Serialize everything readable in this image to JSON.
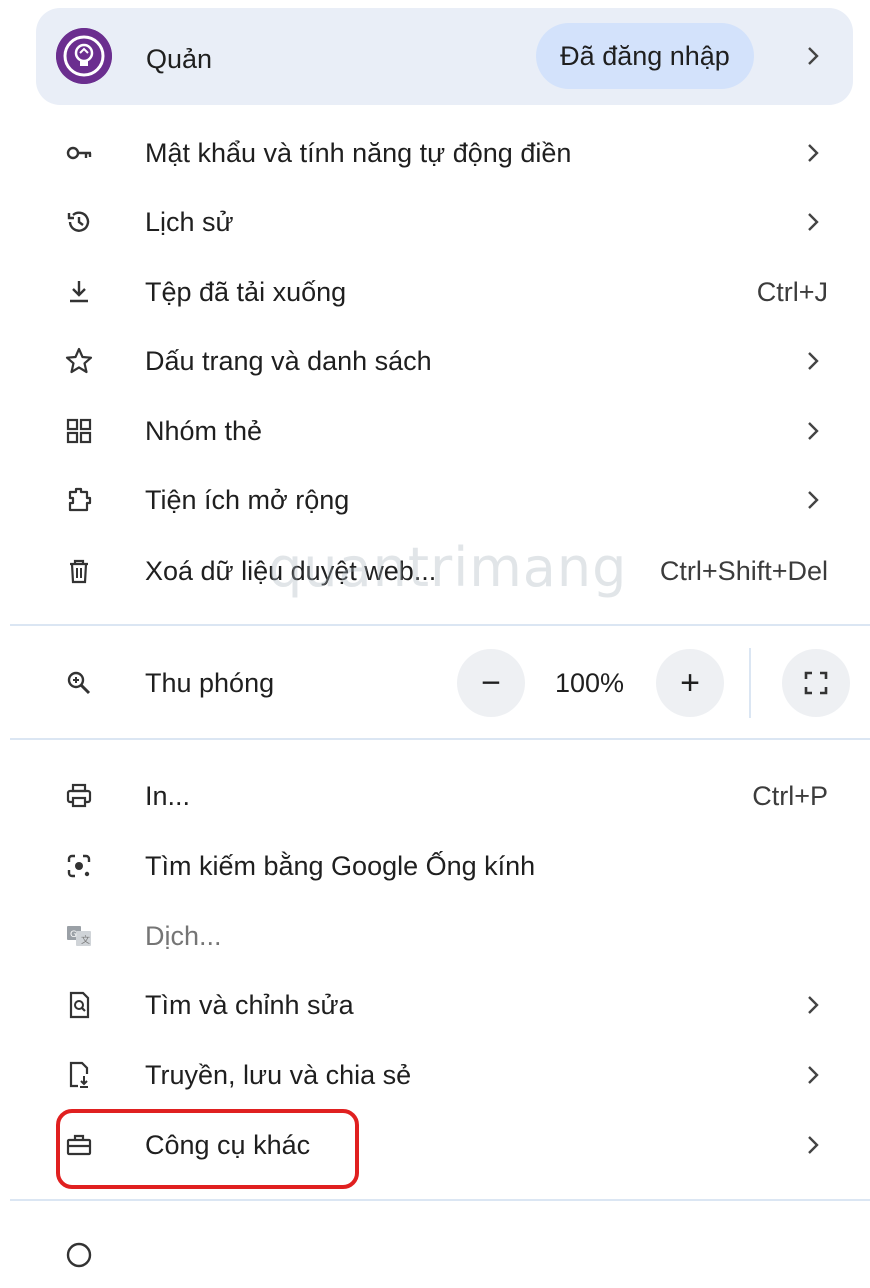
{
  "profile": {
    "name": "Quản",
    "status": "Đã đăng nhập",
    "avatar_color": "#6b2e8f"
  },
  "menu_items": [
    {
      "label": "Mật khẩu và tính năng tự động điền",
      "icon": "key-icon",
      "trailing": "chevron"
    },
    {
      "label": "Lịch sử",
      "icon": "history-icon",
      "trailing": "chevron"
    },
    {
      "label": "Tệp đã tải xuống",
      "icon": "download-icon",
      "shortcut": "Ctrl+J"
    },
    {
      "label": "Dấu trang và danh sách",
      "icon": "star-icon",
      "trailing": "chevron"
    },
    {
      "label": "Nhóm thẻ",
      "icon": "tab-groups-icon",
      "trailing": "chevron"
    },
    {
      "label": "Tiện ích mở rộng",
      "icon": "extension-icon",
      "trailing": "chevron"
    },
    {
      "label": "Xoá dữ liệu duyệt web...",
      "icon": "trash-icon",
      "shortcut": "Ctrl+Shift+Del"
    }
  ],
  "zoom": {
    "label": "Thu phóng",
    "minus": "−",
    "level": "100%",
    "plus": "+"
  },
  "menu_items_2": [
    {
      "label": "In...",
      "icon": "print-icon",
      "shortcut": "Ctrl+P"
    },
    {
      "label": "Tìm kiếm bằng Google Ống kính",
      "icon": "google-lens-icon"
    },
    {
      "label": "Dịch...",
      "icon": "translate-icon",
      "disabled": true
    },
    {
      "label": "Tìm và chỉnh sửa",
      "icon": "find-icon",
      "trailing": "chevron"
    },
    {
      "label": "Truyền, lưu và chia sẻ",
      "icon": "cast-save-icon",
      "trailing": "chevron"
    },
    {
      "label": "Công cụ khác",
      "icon": "toolbox-icon",
      "trailing": "chevron",
      "highlighted": true
    }
  ],
  "watermark": "quantrimang",
  "colors": {
    "highlight_border": "#e02020",
    "profile_bg": "#e9eef7",
    "badge_bg": "#d3e2fb"
  }
}
